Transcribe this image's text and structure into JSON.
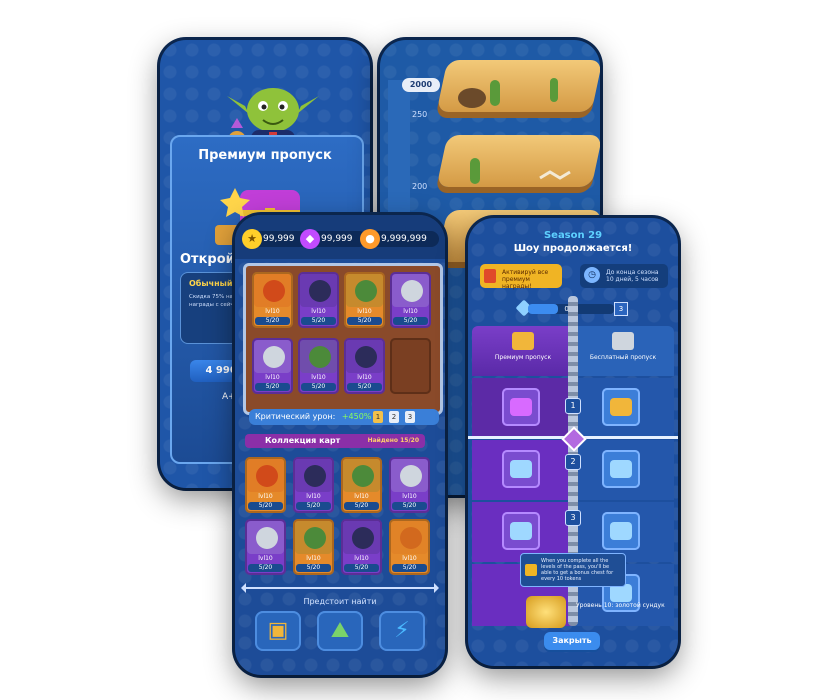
{
  "premium_screen": {
    "title": "Премиум пропуск",
    "open_text": "Откройте",
    "info_header": "Обычный пр",
    "info_text": "Скидка 75% на пр Пропуск +10 уровне больше награды с сейчас!",
    "price": "4 990,00",
    "footer_text": "А+"
  },
  "map_screen": {
    "badge": "2000",
    "levels": [
      "250",
      "200"
    ]
  },
  "cards_screen": {
    "resources": [
      {
        "icon": "star-icon",
        "value": "99,999",
        "color": "#ffcf2a"
      },
      {
        "icon": "gem-icon",
        "value": "99,999",
        "color": "#c14bff"
      },
      {
        "icon": "coin-icon",
        "value": "9,999,999",
        "color": "#ff9a2a"
      }
    ],
    "board_cards": [
      {
        "level": "lvl10",
        "progress": "5/20",
        "color": "#e58a2a",
        "face": "#d14a1a"
      },
      {
        "level": "lvl10",
        "progress": "5/20",
        "color": "#7a3ec8",
        "face": "#2c2c5a"
      },
      {
        "level": "lvl10",
        "progress": "5/20",
        "color": "#e58a2a",
        "face": "#4c8a3a"
      },
      {
        "level": "lvl10",
        "progress": "5/20",
        "color": "#7a3ec8",
        "face": "#cfd6de"
      },
      {
        "level": "lvl10",
        "progress": "5/20",
        "color": "#7a3ec8",
        "face": "#cfd6de"
      },
      {
        "level": "lvl10",
        "progress": "5/20",
        "color": "#7a3ec8",
        "face": "#4c8a3a"
      },
      {
        "level": "lvl10",
        "progress": "5/20",
        "color": "#7a3ec8",
        "face": "#2c2c5a"
      }
    ],
    "crit_label": "Критический урон:",
    "crit_value": "+450%",
    "crit_pills": [
      "1",
      "2",
      "3"
    ],
    "collection_title": "Коллекция карт",
    "collection_count": "Найдено 15/20",
    "collection_cards": [
      {
        "level": "lvl10",
        "progress": "5/20",
        "color": "#e58a2a",
        "face": "#d14a1a"
      },
      {
        "level": "lvl10",
        "progress": "5/20",
        "color": "#7a3ec8",
        "face": "#2c2c5a"
      },
      {
        "level": "lvl10",
        "progress": "5/20",
        "color": "#e58a2a",
        "face": "#4c8a3a"
      },
      {
        "level": "lvl10",
        "progress": "5/20",
        "color": "#7a3ec8",
        "face": "#cfd6de"
      },
      {
        "level": "lvl10",
        "progress": "5/20",
        "color": "#7a3ec8",
        "face": "#cfd6de"
      },
      {
        "level": "lvl10",
        "progress": "5/20",
        "color": "#e58a2a",
        "face": "#4c8a3a"
      },
      {
        "level": "lvl10",
        "progress": "5/20",
        "color": "#7a3ec8",
        "face": "#2c2c5a"
      },
      {
        "level": "lvl10",
        "progress": "5/20",
        "color": "#e58a2a",
        "face": "#d2691e"
      }
    ],
    "coming_soon": "Предстоит найти",
    "bottom_buttons": [
      {
        "name": "chest-button",
        "icon": "▣"
      },
      {
        "name": "map-button",
        "icon": "⛰"
      },
      {
        "name": "cards-button",
        "icon": "⚡"
      }
    ]
  },
  "season_screen": {
    "season": "Season 29",
    "subtitle": "Шоу продолжается!",
    "box_left": "Активируй все премиум награды!",
    "box_right": "До конца сезона 10 дней, 5 часов",
    "progress_label": "013",
    "progress_fraction": 0.35,
    "progress_level": "3",
    "col_premium": "Премиум пропуск",
    "col_free": "Бесплатный пропуск",
    "tier_numbers": [
      "1",
      "2",
      "3"
    ],
    "tooltip": "When you complete all the levels of the pass, you'll be able to get a bonus chest for every 10 tokens",
    "gold_text": "Уровень 10: золотой сундук",
    "close": "Закрыть"
  }
}
